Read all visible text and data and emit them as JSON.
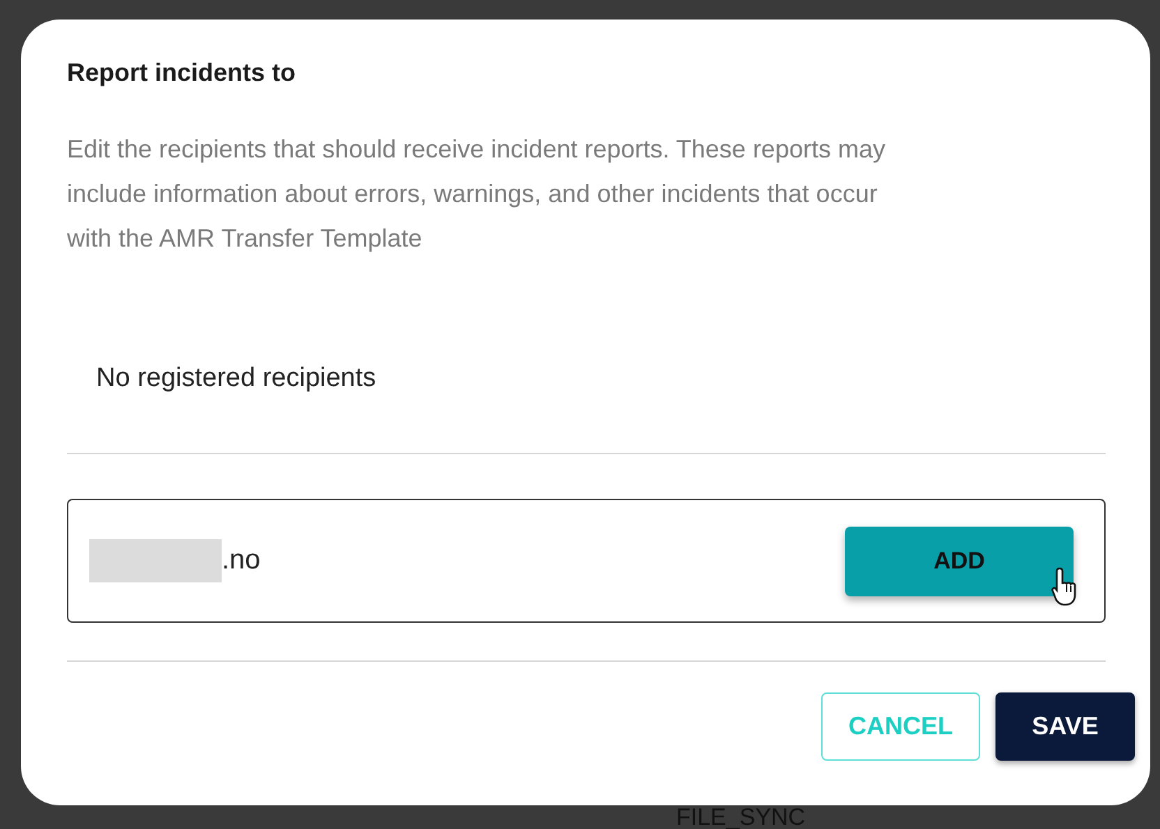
{
  "background": {
    "label": "FILE_SYNC"
  },
  "dialog": {
    "title": "Report incidents to",
    "description": "Edit the recipients that should receive incident reports. These reports may include information about errors, warnings, and other incidents that occur with the AMR Transfer Template",
    "empty_message": "No registered recipients",
    "email_field": {
      "value": ".no"
    },
    "add_button": "ADD",
    "buttons": [
      {
        "label": "CANCEL",
        "kind": "secondary"
      },
      {
        "label": "SAVE",
        "kind": "primary"
      }
    ]
  }
}
